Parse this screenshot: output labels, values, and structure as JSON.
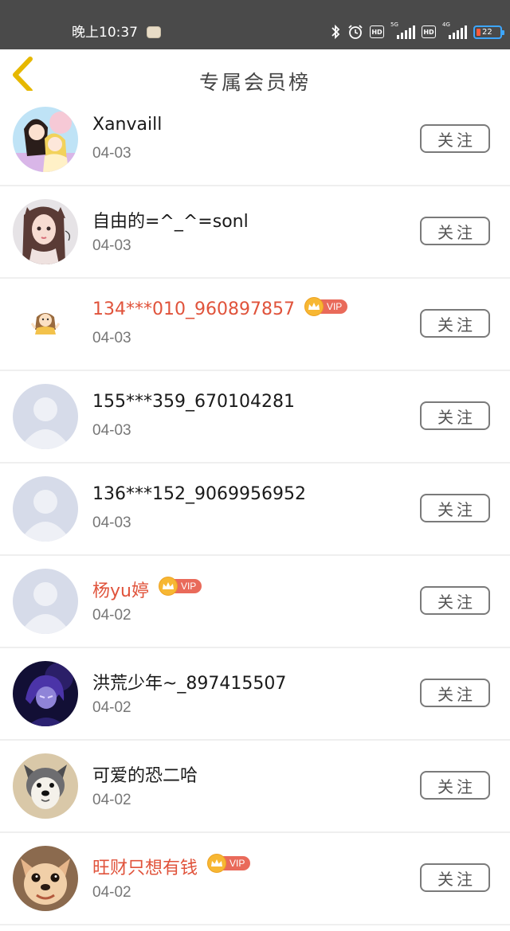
{
  "status_bar": {
    "time": "晚上10:37",
    "hd_label": "HD",
    "net_5g": "5G",
    "net_4g": "4G",
    "battery_level": "22"
  },
  "header": {
    "title": "专属会员榜"
  },
  "follow_label": "关注",
  "vip_label": "VIP",
  "members": [
    {
      "name": "Xanvaill",
      "date": "04-03",
      "vip": false,
      "avatar": "anime-couple-avatar"
    },
    {
      "name": "自由的=^_^=sonl",
      "date": "04-03",
      "vip": false,
      "avatar": "anime-girl-avatar"
    },
    {
      "name": "134***010_960897857",
      "date": "04-03",
      "vip": true,
      "avatar": "cartoon-girl-avatar"
    },
    {
      "name": "155***359_670104281",
      "date": "04-03",
      "vip": false,
      "avatar": "default-avatar"
    },
    {
      "name": "136***152_9069956952",
      "date": "04-03",
      "vip": false,
      "avatar": "default-avatar"
    },
    {
      "name": "杨yu婷",
      "date": "04-02",
      "vip": true,
      "avatar": "default-avatar"
    },
    {
      "name": "洪荒少年~_897415507",
      "date": "04-02",
      "vip": false,
      "avatar": "purple-anime-avatar"
    },
    {
      "name": "可爱的恐二哈",
      "date": "04-02",
      "vip": false,
      "avatar": "plush-dog-avatar"
    },
    {
      "name": "旺财只想有钱",
      "date": "04-02",
      "vip": true,
      "avatar": "dog-photo-avatar"
    }
  ],
  "colors": {
    "vip_name": "#e0533b",
    "status_bar_bg": "#4a4a4a",
    "back_arrow": "#e6b800",
    "vip_badge": "#e96a5a",
    "crown": "#f7b733"
  }
}
